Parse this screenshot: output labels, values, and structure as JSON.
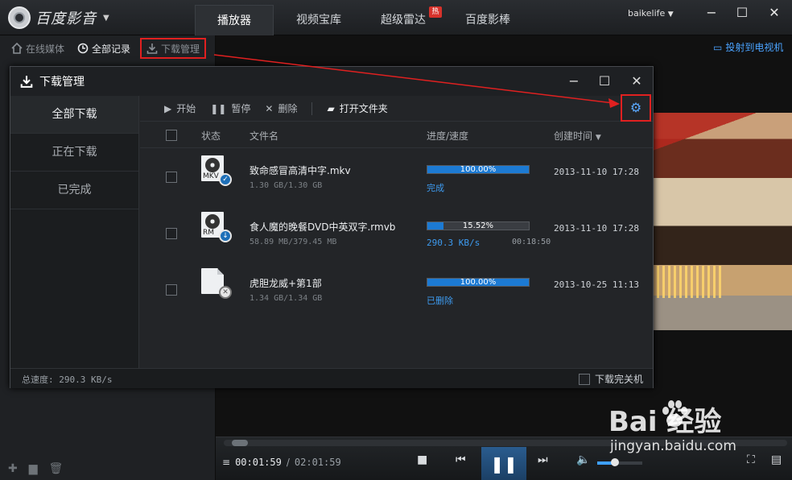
{
  "app": {
    "name": "百度影音",
    "user": "baikelife"
  },
  "nav": {
    "tabs": [
      "播放器",
      "视频宝库",
      "超级雷达",
      "百度影棒"
    ],
    "active": 0,
    "hot_badge": "热"
  },
  "subnav": {
    "items": [
      "在线媒体",
      "全部记录",
      "下载管理"
    ]
  },
  "cast_label": "投射到电视机",
  "dialog": {
    "title": "下载管理",
    "sidebar": [
      "全部下载",
      "正在下载",
      "已完成"
    ],
    "toolbar": {
      "start": "开始",
      "pause": "暂停",
      "delete": "删除",
      "open_folder": "打开文件夹"
    },
    "columns": {
      "status": "状态",
      "filename": "文件名",
      "progress": "进度/速度",
      "created": "创建时间"
    },
    "rows": [
      {
        "ext": "MKV",
        "name": "致命感冒高清中字.mkv",
        "size": "1.30 GB/1.30 GB",
        "progress": 1.0,
        "pct_label": "100.00%",
        "status": "完成",
        "remain": "",
        "created": "2013-11-10 17:28"
      },
      {
        "ext": "RM",
        "name": "食人魔的晚餐DVD中英双字.rmvb",
        "size": "58.89 MB/379.45 MB",
        "progress": 0.1552,
        "pct_label": "15.52%",
        "status": "290.3 KB/s",
        "remain": "00:18:50",
        "created": "2013-11-10 17:28"
      },
      {
        "ext": "",
        "name": "虎胆龙威+第1部",
        "size": "1.34 GB/1.34 GB",
        "progress": 1.0,
        "pct_label": "100.00%",
        "status": "已删除",
        "remain": "",
        "created": "2013-10-25 11:13"
      }
    ],
    "total_speed": "总速度: 290.3 KB/s",
    "shutdown_label": "下载完关机"
  },
  "player": {
    "current": "00:01:59",
    "separator": "/",
    "total": "02:01:59",
    "volume": 0.4
  },
  "watermark": {
    "text": "Bai 经验",
    "url": "jingyan.baidu.com"
  },
  "colors": {
    "accent": "#1c7ad3",
    "link": "#3d9bf0",
    "annotation": "#e02020"
  }
}
